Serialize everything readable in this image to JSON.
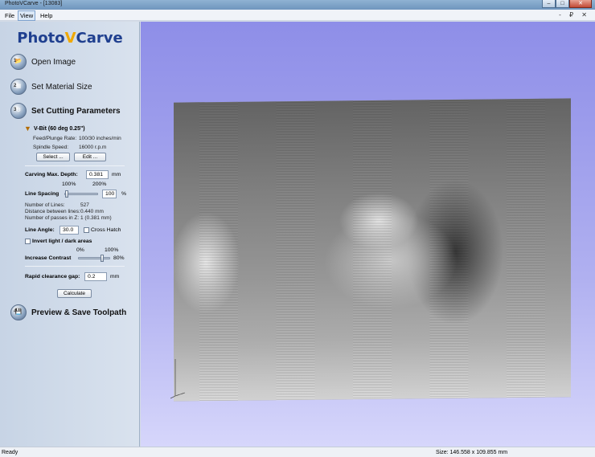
{
  "window": {
    "title": "PhotoVCarve - [13083]",
    "buttons": {
      "minimize": "–",
      "maximize": "□",
      "close": "✕"
    }
  },
  "menu": {
    "items": [
      "File",
      "View",
      "Help"
    ],
    "active": "View",
    "mdi_controls": "- ₽ ✕"
  },
  "logo": {
    "part1": "Photo",
    "part2": "V",
    "part3": "Carve"
  },
  "steps": [
    {
      "num": "1",
      "label": "Open Image"
    },
    {
      "num": "2",
      "label": "Set Material Size"
    },
    {
      "num": "3",
      "label": "Set Cutting Parameters"
    },
    {
      "num": "4",
      "label": "Preview & Save Toolpath"
    }
  ],
  "tool": {
    "name": "V-Bit (60 deg 0.25\")",
    "feed_label": "Feed/Plunge Rate:",
    "feed_value": "100/30 inches/min",
    "spindle_label": "Spindle Speed:",
    "spindle_value": "16000 r.p.m",
    "select_btn": "Select ...",
    "edit_btn": "Edit ..."
  },
  "params": {
    "depth_label": "Carving Max. Depth:",
    "depth_value": "0.381",
    "depth_unit": "mm",
    "pct_100": "100%",
    "pct_200": "200%",
    "spacing_label": "Line Spacing",
    "spacing_value": "100",
    "spacing_unit": "%",
    "spacing_slider_fraction": 0.0,
    "lines_label": "Number of Lines:",
    "lines_value": "527",
    "distance_label": "Distance between lines:",
    "distance_value": "0.440 mm",
    "passes_label": "Number of passes in Z:",
    "passes_value": "1 (0.381 mm)",
    "angle_label": "Line Angle:",
    "angle_value": "30.0",
    "cross_hatch_label": "Cross Hatch",
    "invert_label": "Invert light / dark areas",
    "contrast_min": "0%",
    "contrast_max": "100%",
    "contrast_label": "Increase Contrast",
    "contrast_value": "80%",
    "contrast_fraction": 0.8,
    "clearance_label": "Rapid clearance gap:",
    "clearance_value": "0.2",
    "clearance_unit": "mm",
    "calculate_btn": "Calculate"
  },
  "status": {
    "left": "Ready",
    "right": "Size: 146.558 x 109.855 mm"
  },
  "colors": {
    "logo_blue": "#1f3f8f",
    "logo_orange": "#f0a800",
    "canvas_top": "#8e8ee8",
    "canvas_bottom": "#d6d6fb"
  }
}
